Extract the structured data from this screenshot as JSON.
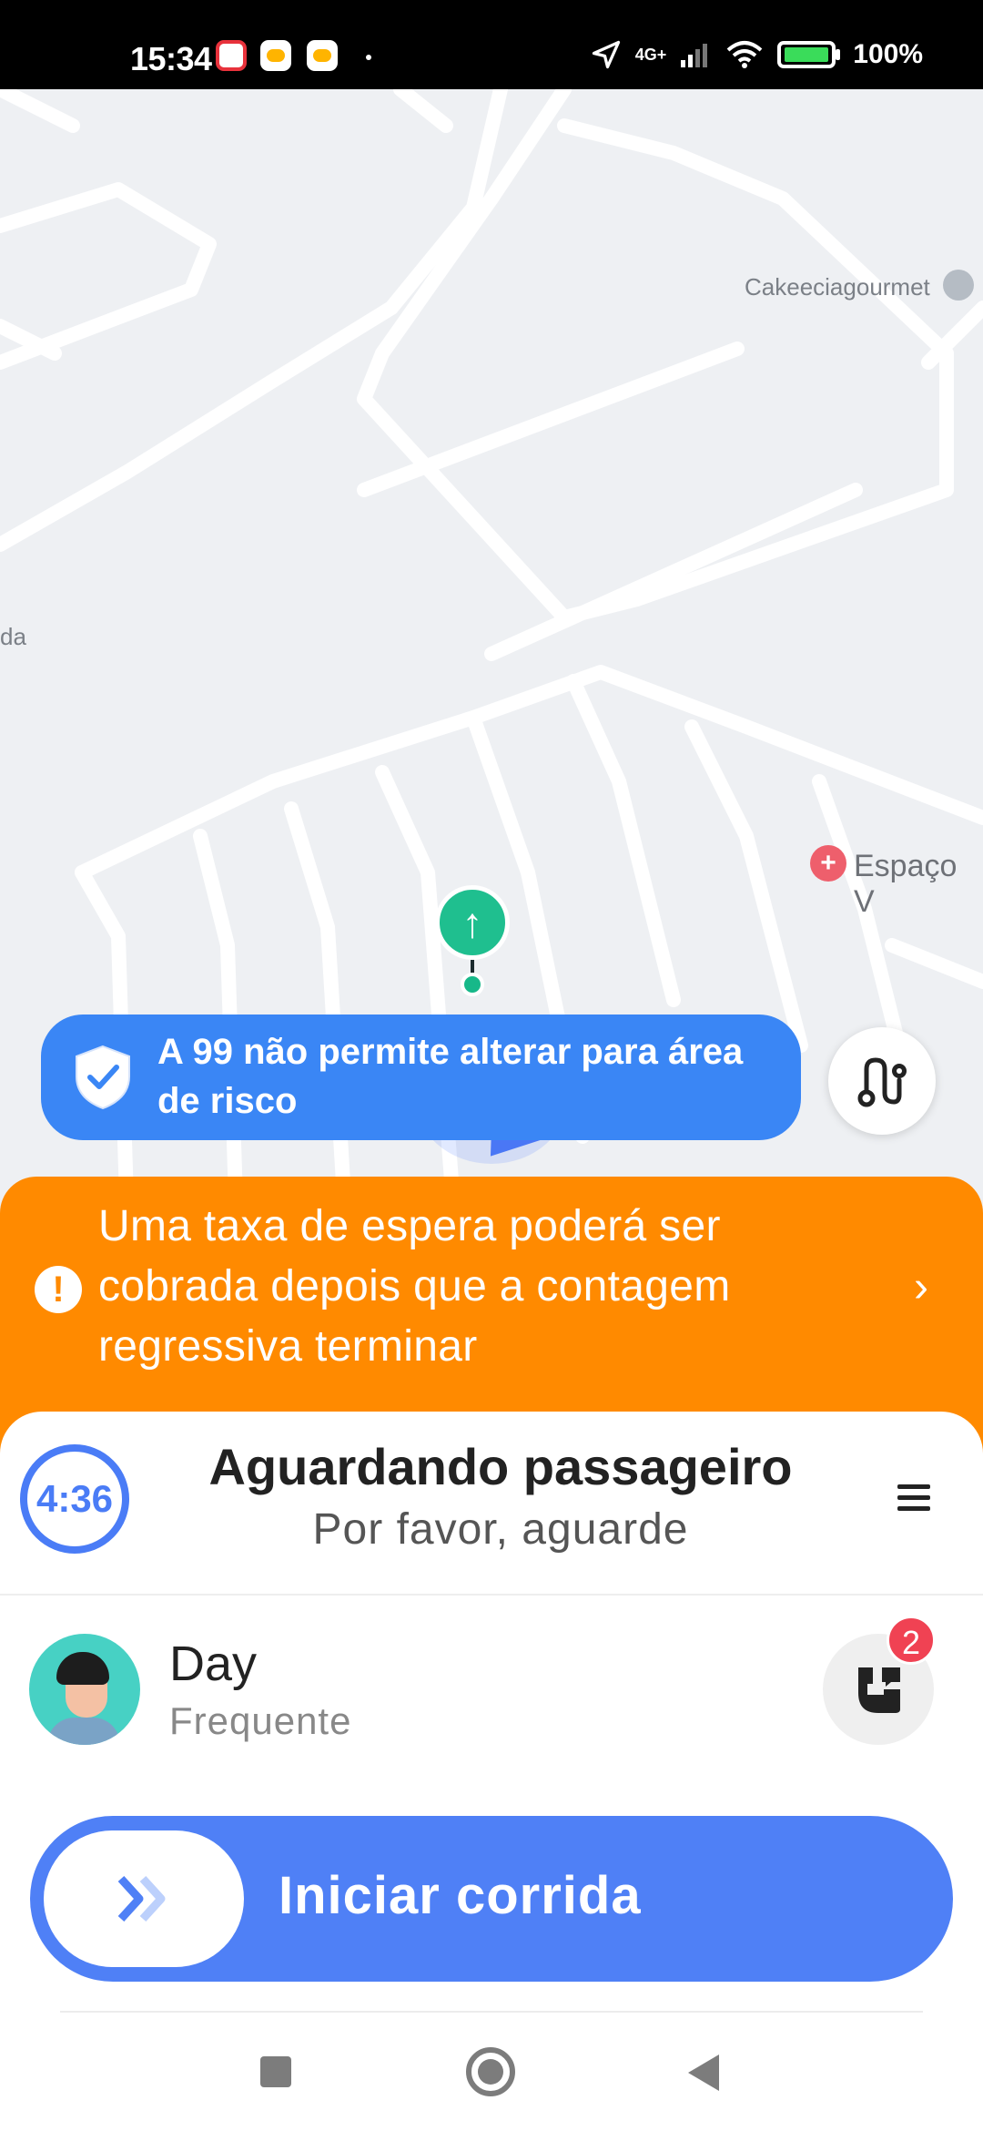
{
  "status_bar": {
    "time": "15:34",
    "network": "4G+",
    "battery": "100%",
    "icons": [
      "mail-icon",
      "99-app-icon",
      "99-app-icon",
      "location-arrow-icon",
      "signal-icon",
      "wifi-icon",
      "battery-charging-icon"
    ]
  },
  "map": {
    "poi_labels": [
      "Cakeeciagourmet",
      "da",
      "Espaço V"
    ],
    "navigation_arrow_icon": "arrow-up-icon"
  },
  "risk_banner": {
    "text": "A 99 não permite alterar para área de risco",
    "icon": "shield-check-icon"
  },
  "route_button": {
    "icon": "route-icon"
  },
  "wait_notice": {
    "text": "Uma taxa de espera poderá ser cobrada depois que a contagem regressiva terminar",
    "icon": "warning-icon",
    "chevron": "›"
  },
  "status_panel": {
    "timer": "4:36",
    "title": "Aguardando passageiro",
    "subtitle": "Por favor, aguarde"
  },
  "passenger": {
    "name": "Day",
    "tag": "Frequente",
    "call_badge_count": "2"
  },
  "start_button": {
    "label": "Iniciar corrida"
  },
  "colors": {
    "primary_blue": "#4f80f6",
    "banner_blue": "#3a86f5",
    "warning_orange": "#ff8a00",
    "badge_red": "#f04253",
    "marker_green": "#1fbf8f"
  }
}
